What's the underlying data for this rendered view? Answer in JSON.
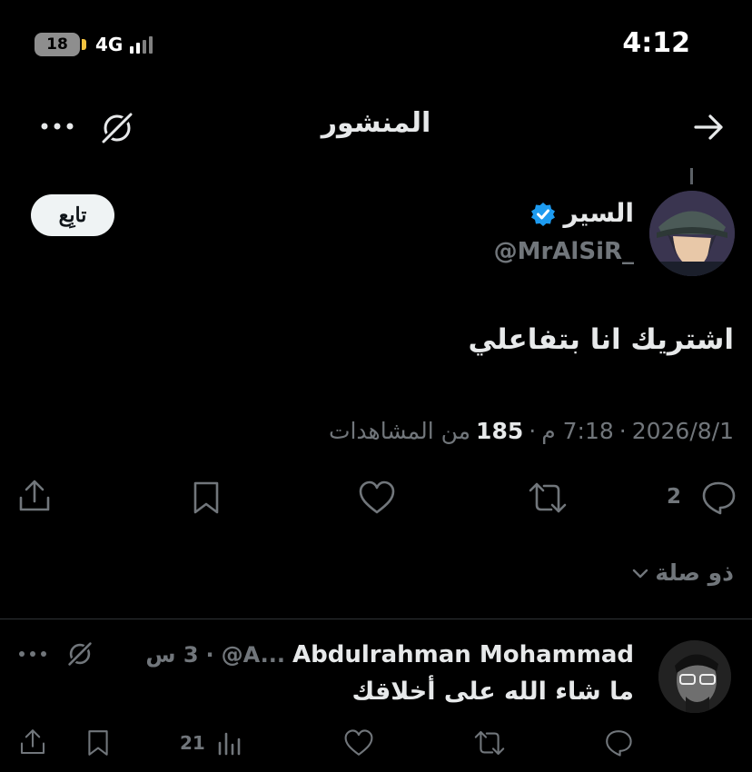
{
  "status_bar": {
    "time": "4:12",
    "battery": "18",
    "network": "4G"
  },
  "header": {
    "title": "المنشور"
  },
  "post": {
    "author_name": "السير",
    "author_handle": "@MrAlSiR_",
    "follow_label": "تابِع",
    "text": "اشتريك انا بتفاعلي",
    "date": "2026/8/1",
    "time": "7:18 م",
    "views_count": "185",
    "views_label": "من المشاهدات",
    "reply_count": "2"
  },
  "related": {
    "label": "ذو صلة"
  },
  "reply": {
    "name": "Abdulrahman Mohammad",
    "handle": "@A...",
    "time": "3 س",
    "text": "ما شاء الله على أخلاقك",
    "views": "21"
  },
  "colors": {
    "background": "#000000",
    "text_primary": "#e7e9ea",
    "text_secondary": "#71767b",
    "verified": "#1d9bf0",
    "battery_tip": "#f4c33f"
  },
  "icons": [
    "back-arrow-icon",
    "grok-icon",
    "more-icon",
    "verified-icon",
    "reply-icon",
    "retweet-icon",
    "like-icon",
    "bookmark-icon",
    "share-icon",
    "chevron-down-icon",
    "views-icon"
  ]
}
